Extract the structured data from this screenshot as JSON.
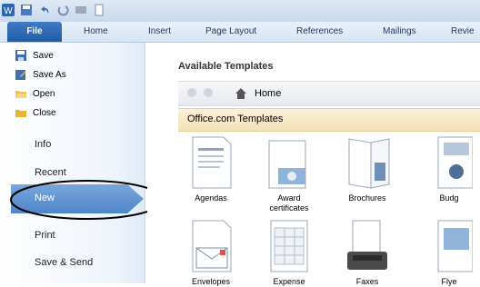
{
  "ribbon": {
    "tabs": [
      "File",
      "Home",
      "Insert",
      "Page Layout",
      "References",
      "Mailings",
      "Revie"
    ]
  },
  "backstage": {
    "commands": [
      "Save",
      "Save As",
      "Open",
      "Close"
    ],
    "items": [
      "Info",
      "Recent",
      "New",
      "Print",
      "Save & Send"
    ]
  },
  "main": {
    "title": "Available Templates",
    "nav_home": "Home",
    "section": "Office.com Templates",
    "templates_row1": [
      "Agendas",
      "Award certificates",
      "Brochures",
      "Budg"
    ],
    "templates_row2": [
      "Envelopes",
      "Expense",
      "Faxes",
      "Flye"
    ]
  },
  "colors": {
    "file_tab": "#2a66b3",
    "selected": "#5a8fd0",
    "annotation": "#000000"
  }
}
